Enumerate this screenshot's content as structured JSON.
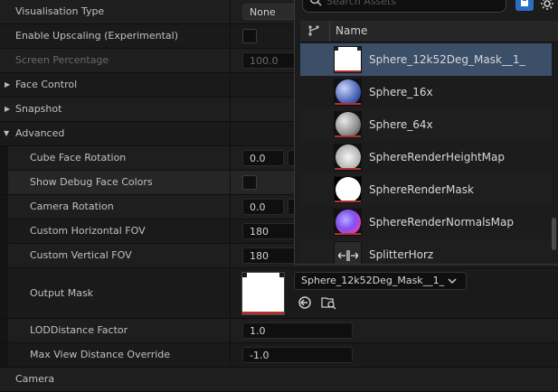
{
  "properties": {
    "visualisation_type": {
      "label": "Visualisation Type",
      "value": "None"
    },
    "enable_upscaling": {
      "label": "Enable Upscaling (Experimental)"
    },
    "screen_percentage": {
      "label": "Screen Percentage",
      "value": "100.0"
    },
    "face_control": {
      "label": "Face Control"
    },
    "snapshot": {
      "label": "Snapshot"
    },
    "advanced": {
      "label": "Advanced"
    },
    "cube_face_rotation": {
      "label": "Cube Face Rotation",
      "value": "0.0"
    },
    "show_debug_face_colors": {
      "label": "Show Debug Face Colors"
    },
    "camera_rotation": {
      "label": "Camera Rotation",
      "value": "0.0"
    },
    "custom_horizontal_fov": {
      "label": "Custom Horizontal FOV",
      "value": "180"
    },
    "custom_vertical_fov": {
      "label": "Custom Vertical FOV",
      "value": "180"
    },
    "output_mask": {
      "label": "Output Mask",
      "selected_asset": "Sphere_12k52Deg_Mask__1_"
    },
    "lod_distance_factor": {
      "label": "LODDistance Factor",
      "value": "1.0"
    },
    "max_view_distance_override": {
      "label": "Max View Distance Override",
      "value": "-1.0"
    },
    "camera_section": {
      "label": "Camera"
    }
  },
  "asset_picker": {
    "search_placeholder": "Search Assets",
    "column_header": "Name",
    "assets": [
      {
        "name": "Sphere_12k52Deg_Mask__1_"
      },
      {
        "name": "Sphere_16x"
      },
      {
        "name": "Sphere_64x"
      },
      {
        "name": "SphereRenderHeightMap"
      },
      {
        "name": "SphereRenderMask"
      },
      {
        "name": "SphereRenderNormalsMap"
      },
      {
        "name": "SplitterHorz"
      }
    ]
  },
  "colors": {
    "selection": "#3b4f69",
    "accent_blue": "#2a6dc2",
    "thumb_bar": "#b03030"
  },
  "icons": [
    "search-icon",
    "settings-gear-icon",
    "filter-icon",
    "dropdown-chevron-icon",
    "use-selected-icon",
    "browse-asset-icon",
    "expand-arrow-icon"
  ]
}
